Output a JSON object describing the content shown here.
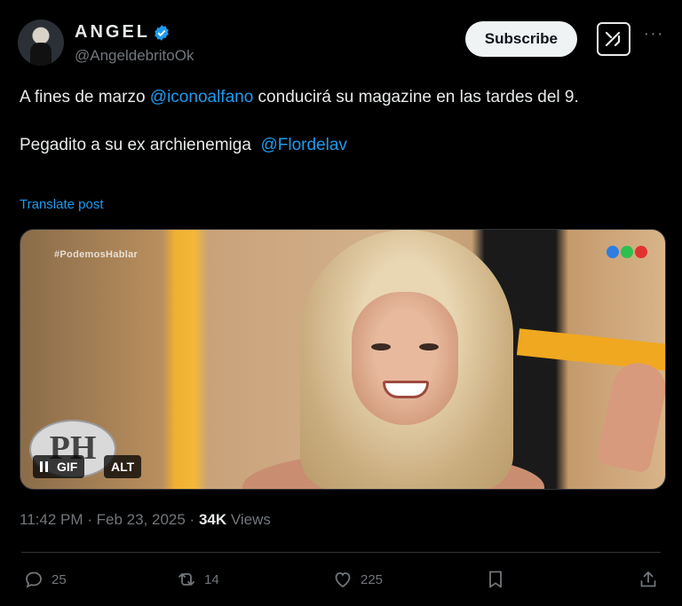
{
  "author": {
    "display_name": "ANGEL",
    "handle": "@AngeldebritoOk",
    "verified": true
  },
  "header": {
    "subscribe_label": "Subscribe",
    "grok_icon": "grok-icon",
    "more_icon": "more-icon"
  },
  "tweet": {
    "line1_prefix": "A fines de marzo ",
    "mention1": "@iconoalfano",
    "line1_suffix": " conducirá su magazine en las tardes del 9.",
    "line2_prefix": "Pegadito a su ex archienemiga  ",
    "mention2": "@Flordelav",
    "translate_label": "Translate post"
  },
  "media": {
    "watermark": "#PodemosHablar",
    "logo_text": "PH",
    "gif_label": "GIF",
    "alt_label": "ALT",
    "channel_dot_colors": [
      "#2f7de1",
      "#2fbf4f",
      "#e0332f"
    ]
  },
  "meta": {
    "time": "11:42 PM",
    "separator": " · ",
    "date": "Feb 23, 2025",
    "views_count": "34K",
    "views_label": " Views"
  },
  "actions": {
    "replies": "25",
    "reposts": "14",
    "likes": "225"
  },
  "colors": {
    "accent": "#1d9bf0",
    "muted": "#71767b",
    "text": "#e7e9ea",
    "background": "#000000"
  }
}
